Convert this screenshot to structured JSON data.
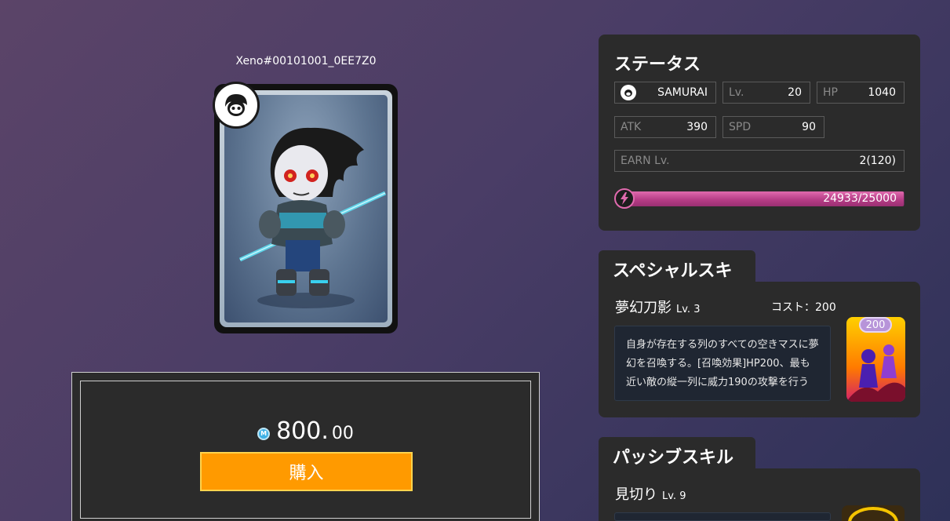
{
  "nft": {
    "id": "Xeno#00101001_0EE7Z0"
  },
  "purchase": {
    "price_int": "800.",
    "price_dec": "00",
    "coin_symbol": "M",
    "buy_label": "購入"
  },
  "status": {
    "title": "ステータス",
    "class_name": "SAMURAI",
    "level_label": "Lv.",
    "level_value": "20",
    "hp_label": "HP",
    "hp_value": "1040",
    "atk_label": "ATK",
    "atk_value": "390",
    "spd_label": "SPD",
    "spd_value": "90",
    "earn_label": "EARN Lv.",
    "earn_value": "2(120)",
    "energy_text": "24933/25000",
    "energy_current": 24933,
    "energy_max": 25000
  },
  "special_skill": {
    "tab_label": "スペシャルスキル",
    "name": "夢幻刀影",
    "level": "Lv. 3",
    "cost": "コスト：200",
    "description": "自身が存在する列のすべての空きマスに夢幻を召喚する。[召喚効果]HP200、最も近い敵の縦一列に威力190の攻撃を行う",
    "badge": "200"
  },
  "passive_skill_1": {
    "tab_label": "パッシブスキル 1",
    "name": "見切り",
    "level": "Lv. 9"
  },
  "colors": {
    "buy_button": "#ff9a00",
    "energy_bar": "#c8458f",
    "panel": "#2b2b2b"
  }
}
